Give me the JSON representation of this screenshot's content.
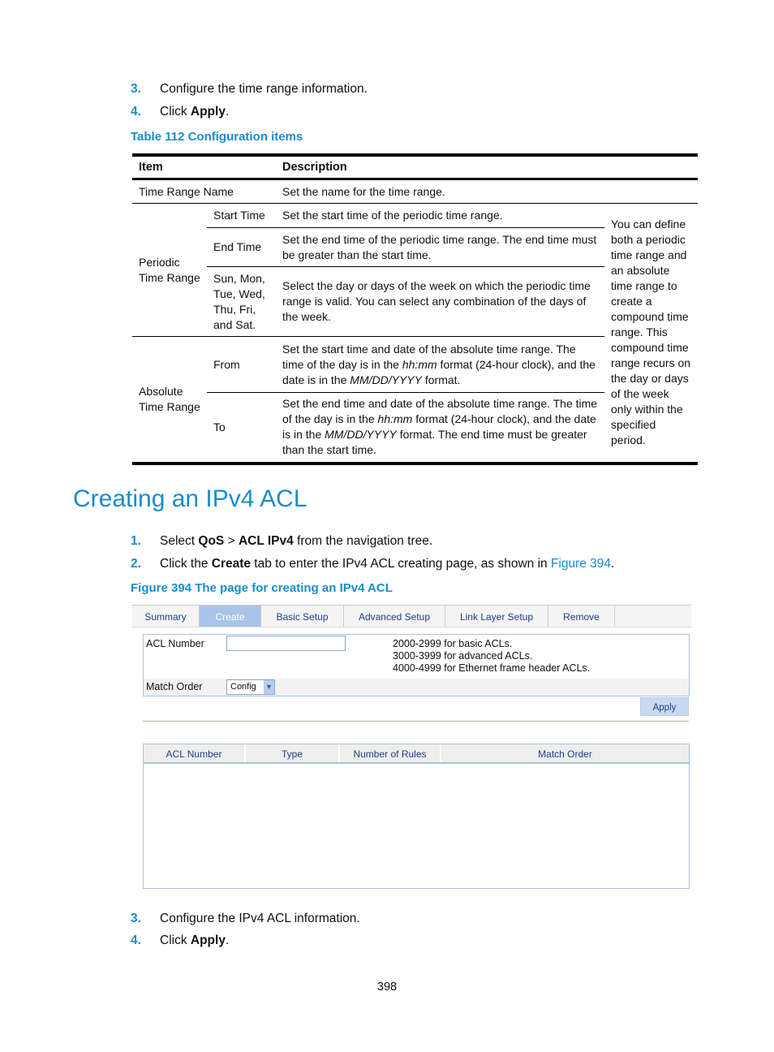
{
  "steps_top": [
    {
      "num": "3.",
      "text": "Configure the time range information."
    },
    {
      "num": "4.",
      "pre": "Click ",
      "bold": "Apply",
      "post": "."
    }
  ],
  "table_caption": "Table 112 Configuration items",
  "table": {
    "headers": [
      "Item",
      "Description"
    ],
    "time_range_name": {
      "item": "Time Range Name",
      "desc": "Set the name for the time range."
    },
    "periodic": {
      "item": "Periodic Time Range",
      "rows": [
        {
          "sub": "Start Time",
          "desc": "Set the start time of the periodic time range."
        },
        {
          "sub": "End Time",
          "desc": "Set the end time of the periodic time range. The end time must be greater than the start time."
        },
        {
          "sub": "Sun, Mon, Tue, Wed, Thu, Fri, and Sat.",
          "desc": "Select the day or days of the week on which the periodic time range is valid. You can select any combination of the days of the week."
        }
      ]
    },
    "absolute": {
      "item": "Absolute Time Range",
      "rows": [
        {
          "sub": "From",
          "d1": "Set the start time and date of the absolute time range. The time of the day is in the ",
          "i1": "hh:mm",
          "d2": " format (24-hour clock), and the date is in the ",
          "i2": "MM/DD/YYYY",
          "d3": " format."
        },
        {
          "sub": "To",
          "d1": "Set the end time and date of the absolute time range. The time of the day is in the ",
          "i1": "hh:mm",
          "d2": " format (24-hour clock), and the date is in the ",
          "i2": "MM/DD/YYYY",
          "d3": " format. The end time must be greater than the start time."
        }
      ]
    },
    "note": "You can define both a periodic time range and an absolute time range to create a compound time range. This compound time range recurs on the day or days of the week only within the specified period."
  },
  "section_title": "Creating an IPv4 ACL",
  "steps_mid": [
    {
      "num": "1.",
      "pre": "Select ",
      "b1": "QoS",
      "mid": " > ",
      "b2": "ACL IPv4",
      "post": " from the navigation tree."
    },
    {
      "num": "2.",
      "pre": "Click the ",
      "b1": "Create",
      "mid": " tab to enter the IPv4 ACL creating page, as shown in ",
      "link": "Figure 394",
      "post": "."
    }
  ],
  "figure_caption": "Figure 394 The page for creating an IPv4 ACL",
  "ui": {
    "tabs": [
      "Summary",
      "Create",
      "Basic Setup",
      "Advanced Setup",
      "Link Layer Setup",
      "Remove"
    ],
    "active_tab": "Create",
    "acl_number_label": "ACL Number",
    "acl_number_value": "",
    "hints": [
      "2000-2999 for basic ACLs.",
      "3000-3999 for advanced ACLs.",
      "4000-4999 for Ethernet frame header ACLs."
    ],
    "match_order_label": "Match Order",
    "match_order_value": "Config",
    "apply": "Apply",
    "columns": [
      "ACL Number",
      "Type",
      "Number of Rules",
      "Match Order"
    ]
  },
  "steps_bottom": [
    {
      "num": "3.",
      "text": "Configure the IPv4 ACL information."
    },
    {
      "num": "4.",
      "pre": "Click ",
      "bold": "Apply",
      "post": "."
    }
  ],
  "page_number": "398"
}
